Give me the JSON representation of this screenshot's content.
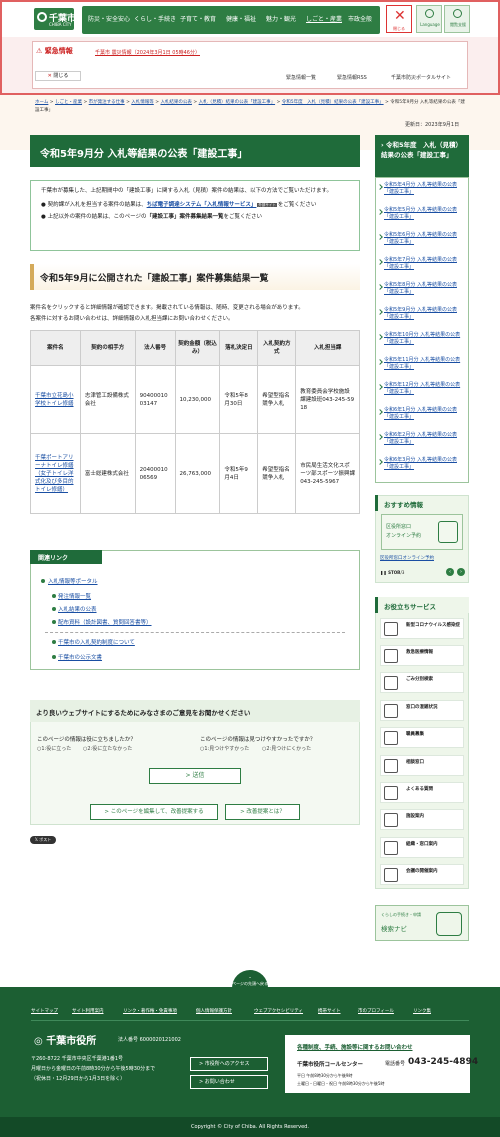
{
  "header": {
    "logo_text": "千葉市",
    "logo_sub": "CHIBA CITY",
    "nav": [
      "防災・安全安心",
      "くらし・手続き",
      "子育て・教育",
      "健康・福祉",
      "魅力・観光",
      "しごと・産業",
      "市政全般"
    ],
    "close_label": "閉じる",
    "language_label": "Language",
    "viewer_label": "閲覧支援"
  },
  "emergency": {
    "label": "緊急情報",
    "close_label": "閉じる",
    "item": "千葉市 震災情報（2024年3月1日 05時46分）",
    "links": [
      "緊急情報一覧",
      "緊急情報RSS",
      "千葉市防災ポータルサイト"
    ]
  },
  "breadcrumb": [
    "ホーム",
    "しごと・産業",
    "市が発注する仕事",
    "入札情報等",
    "入札結果の公表",
    "入札（見積）結果の公表「建設工事」",
    "令和5年度　入札（見積）結果の公表「建設工事」",
    "令和5年9月分 入札等結果の公表「建設工事」"
  ],
  "updated": "更新日：2023年9月1日",
  "page_title": "令和5年9月分 入札等結果の公表「建設工事」",
  "intro": {
    "para": "千葉市が募集した、上記期間中の「建設工事」に関する入札（見積）案件の結果は、以下の方法でご覧いただけます。",
    "bullet1_pre": "契約課が入札を担当する案件の結果は、",
    "bullet1_link": "ちば電子調達システム「入札情報サービス」",
    "bullet1_badge": "外部サイト",
    "bullet1_post": "をご覧ください",
    "bullet2_pre": "上記以外の案件の結果は、このページの",
    "bullet2_bold": "「建設工事」案件募集結果一覧",
    "bullet2_post": "をご覧ください"
  },
  "section_title": "令和5年9月に公開された「建設工事」案件募集結果一覧",
  "notes": [
    "案件名をクリックすると詳細情報が確認できます。掲載されている情報は、随時、変更される場合があります。",
    "各案件に対するお問い合わせは、詳細情報の入札担当課にお問い合わせください。"
  ],
  "table": {
    "headers": [
      "案件名",
      "契約の相手方",
      "法人番号",
      "契約金額（税込み）",
      "落札決定日",
      "入札契約方式",
      "入札担当課"
    ],
    "rows": [
      {
        "name": "千葉市立花島小学校トイレ修繕",
        "partner": "志津管工設備株式会社",
        "corp": "9040001003147",
        "amount": "10,230,000",
        "date": "令和5年8月30日",
        "method": "希望型指名競争入札",
        "dept": "教育委員会学校施設課建設班043-245-5918"
      },
      {
        "name": "千葉ポートアリーナトイレ修繕（女子トイレ洋式化及び多目的トイレ修繕）",
        "partner": "富士総建株式会社",
        "corp": "2040001006569",
        "amount": "26,763,000",
        "date": "令和5年9月4日",
        "method": "希望型指名競争入札",
        "dept": "市民局生活文化スポーツ部スポーツ振興課043-245-5967"
      }
    ]
  },
  "related": {
    "title": "関連リンク",
    "top": "入札情報等ポータル",
    "sub": [
      "発注情報一覧",
      "入札結果の公表",
      "配布資料（設計図書、質問回答書等）"
    ],
    "more": [
      "千葉市の入札契約制度について",
      "千葉市の公示文書"
    ]
  },
  "survey": {
    "title": "より良いウェブサイトにするためにみなさまのご意見をお聞かせください",
    "q1": "このページの情報は役に立ちましたか？",
    "q1_opts": [
      "1:役に立った",
      "2:役に立たなかった"
    ],
    "q2": "このページの情報は見つけやすかったですか？",
    "q2_opts": [
      "1:見つけやすかった",
      "2:見つけにくかった"
    ],
    "send": "送信",
    "edit_btn": "このページを編集して、改善提案する",
    "about_btn": "改善提案とは？"
  },
  "tweet_label": "ポスト",
  "sidebar": {
    "title": "令和5年度　入札（見積）結果の公表「建設工事」",
    "items": [
      "令和5年4月分 入札等結果の公表「建設工事」",
      "令和5年5月分 入札等結果の公表「建設工事」",
      "令和5年6月分 入札等結果の公表「建設工事」",
      "令和5年7月分 入札等結果の公表「建設工事」",
      "令和5年8月分 入札等結果の公表「建設工事」",
      "令和5年9月分 入札等結果の公表「建設工事」",
      "令和5年10月分 入札等結果の公表「建設工事」",
      "令和5年11月分 入札等結果の公表「建設工事」",
      "令和5年12月分 入札等結果の公表「建設工事」",
      "令和6年1月分 入札等結果の公表「建設工事」",
      "令和6年2月分 入札等結果の公表「建設工事」",
      "令和6年3月分 入札等結果の公表「建設工事」"
    ],
    "rec_title": "おすすめ情報",
    "rec_img_line1": "区役所窓口",
    "rec_img_line2": "オンライン予約",
    "rec_link": "区役所窓口オンライン予約",
    "rec_stop": "STOP",
    "rec_page": "1/3",
    "svc_title": "お役立ちサービス",
    "services": [
      "新型コロナウイルス感染症",
      "救急医療情報",
      "ごみ分別検索",
      "窓口の混雑状況",
      "職員募集",
      "相談窓口",
      "よくある質問",
      "施設案内",
      "組織・窓口案内",
      "会議の開催案内"
    ],
    "navi_line1": "くらしの手続き・申請",
    "navi_line2": "検索ナビ"
  },
  "footer": {
    "pagetop": "ページの先頭へ戻る",
    "links": [
      "サイトマップ",
      "サイト利用案内",
      "リンク・著作権・免責事項",
      "個人情報保護方針",
      "ウェブアクセシビリティ",
      "携帯サイト",
      "市のプロフィール",
      "リンク集"
    ],
    "name": "千葉市役所",
    "corp_no": "法人番号 6000020121002",
    "addr": [
      "〒260-8722 千葉市中央区千葉港1番1号",
      "月曜日から金曜日の午前8時30分から午後5時30分まで",
      "（祝休日・12月29日から1月3日を除く）"
    ],
    "access": "市役所へのアクセス",
    "inquiry": "お問い合わせ",
    "contact_title": "各種制度、手続、施設等に関するお問い合わせ",
    "contact_center": "千葉市役所コールセンター",
    "tel_label": "電話番号",
    "tel": "043-245-4894",
    "hours1": "平日 午前8時30分から午後9時",
    "hours2": "土曜日・日曜日・祝日 午前8時30分から午後5時",
    "copyright": "Copyright © City of Chiba. All Rights Reserved."
  }
}
